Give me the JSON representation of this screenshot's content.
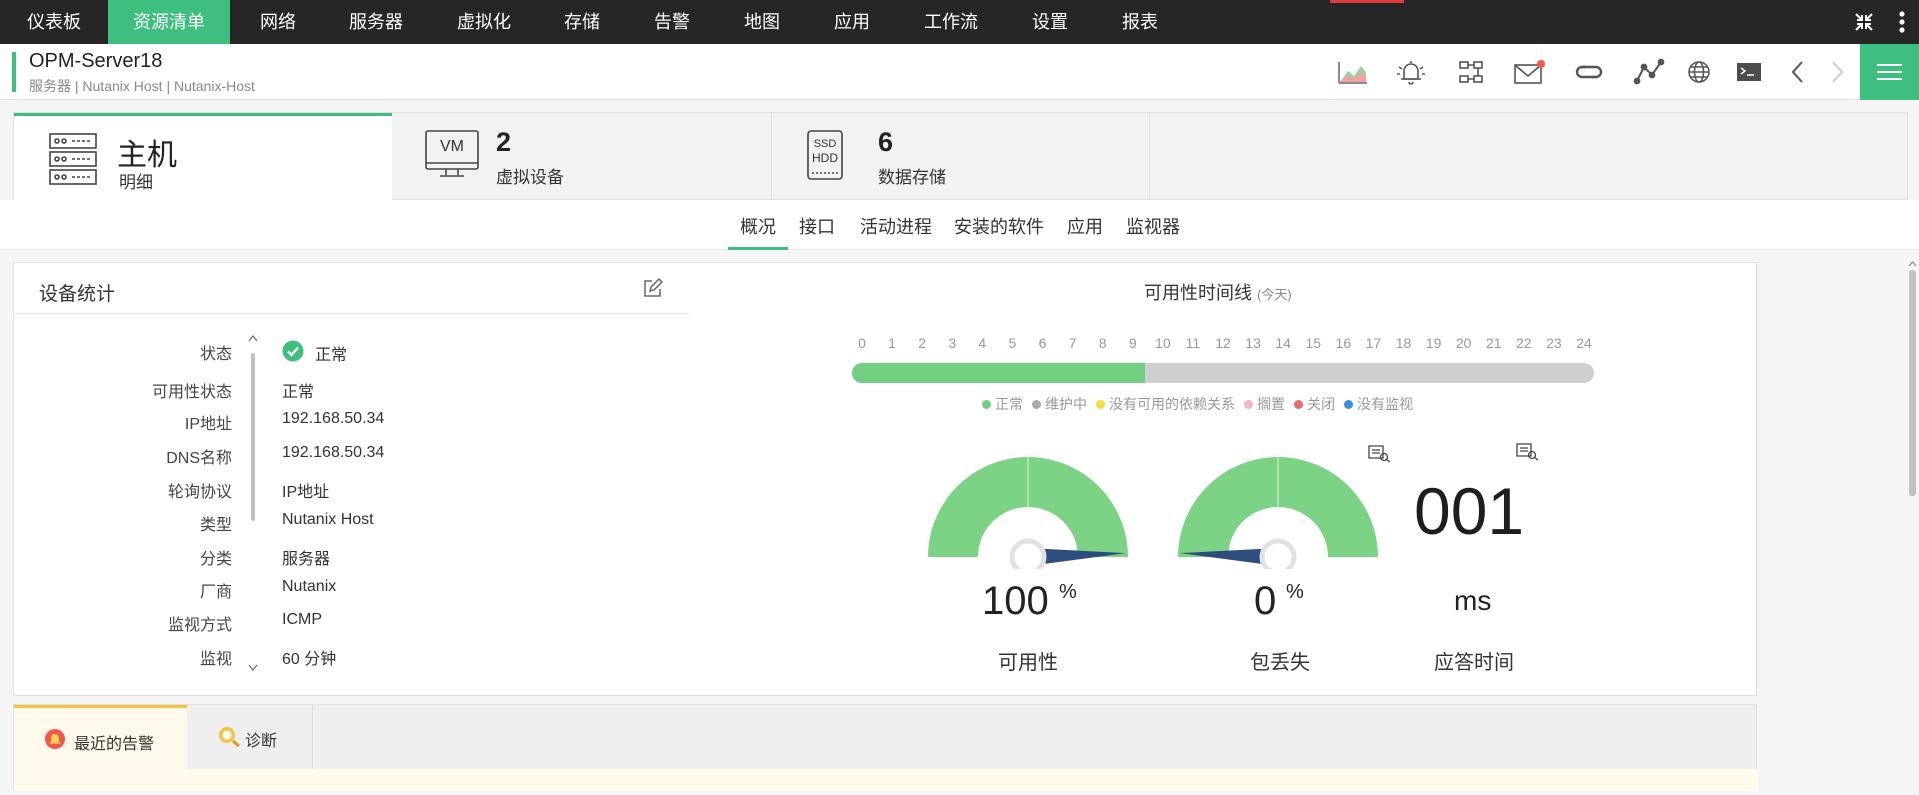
{
  "nav": {
    "items": [
      "仪表板",
      "资源清单",
      "网络",
      "服务器",
      "虚拟化",
      "存储",
      "告警",
      "地图",
      "应用",
      "工作流",
      "设置",
      "报表"
    ],
    "active_index": 1,
    "collapse_icon": "collapse-arrows-icon",
    "more_icon": "vertical-dots-icon"
  },
  "header": {
    "title": "OPM-Server18",
    "subtitle": "服务器 | Nutanix Host  | Nutanix-Host",
    "icons": [
      "chart-icon",
      "alarm-bell-icon",
      "network-map-icon",
      "mail-icon",
      "sync-icon",
      "graph-icon",
      "globe-icon",
      "terminal-icon",
      "prev-arrow-icon",
      "next-arrow-icon",
      "hamburger-menu-icon"
    ]
  },
  "summary": {
    "host_title": "主机",
    "host_sub": "明细",
    "vm_icon_text": "VM",
    "vm_count": "2",
    "vm_label": "虚拟设备",
    "ssd_icon_top": "SSD",
    "ssd_icon_bottom": "HDD",
    "ds_count": "6",
    "ds_label": "数据存储"
  },
  "subtabs": [
    "概况",
    "接口",
    "活动进程",
    "安装的软件",
    "应用",
    "监视器"
  ],
  "stats": {
    "title": "设备统计",
    "rows": [
      {
        "label": "状态",
        "value": "正常"
      },
      {
        "label": "可用性状态",
        "value": "正常"
      },
      {
        "label": "IP地址",
        "value": "192.168.50.34"
      },
      {
        "label": "DNS名称",
        "value": "192.168.50.34"
      },
      {
        "label": "轮询协议",
        "value": "IP地址"
      },
      {
        "label": "类型",
        "value": "Nutanix Host"
      },
      {
        "label": "分类",
        "value": "服务器"
      },
      {
        "label": "厂商",
        "value": "Nutanix"
      },
      {
        "label": "监视方式",
        "value": "ICMP"
      },
      {
        "label": "监视",
        "value": "60 分钟"
      }
    ]
  },
  "availability": {
    "title": "可用性时间线",
    "title_note": "(今天)",
    "hours": [
      "0",
      "1",
      "2",
      "3",
      "4",
      "5",
      "6",
      "7",
      "8",
      "9",
      "10",
      "11",
      "12",
      "13",
      "14",
      "15",
      "16",
      "17",
      "18",
      "19",
      "20",
      "21",
      "22",
      "23",
      "24"
    ],
    "up_fraction": 0.395,
    "legend": [
      {
        "label": "正常",
        "color": "#72cf82"
      },
      {
        "label": "维护中",
        "color": "#aaaaaa"
      },
      {
        "label": "没有可用的依赖关系",
        "color": "#f4dc3a"
      },
      {
        "label": "搁置",
        "color": "#f6b4c8"
      },
      {
        "label": "关闭",
        "color": "#e86a6a"
      },
      {
        "label": "没有监视",
        "color": "#3a8ee6"
      }
    ]
  },
  "gauges": {
    "availability": {
      "value": "100",
      "unit": "%",
      "label": "可用性",
      "fraction": 1.0
    },
    "packet_loss": {
      "value": "0",
      "unit": "%",
      "label": "包丢失",
      "fraction": 0.0
    },
    "response": {
      "value": "001",
      "unit": "ms",
      "label": "应答时间"
    }
  },
  "bottom_tabs": [
    "最近的告警",
    "诊断"
  ],
  "colors": {
    "accent": "#3fbf7f",
    "nav_bg": "#262626",
    "gauge_green": "#7dd385",
    "needle": "#2d4d7c"
  }
}
